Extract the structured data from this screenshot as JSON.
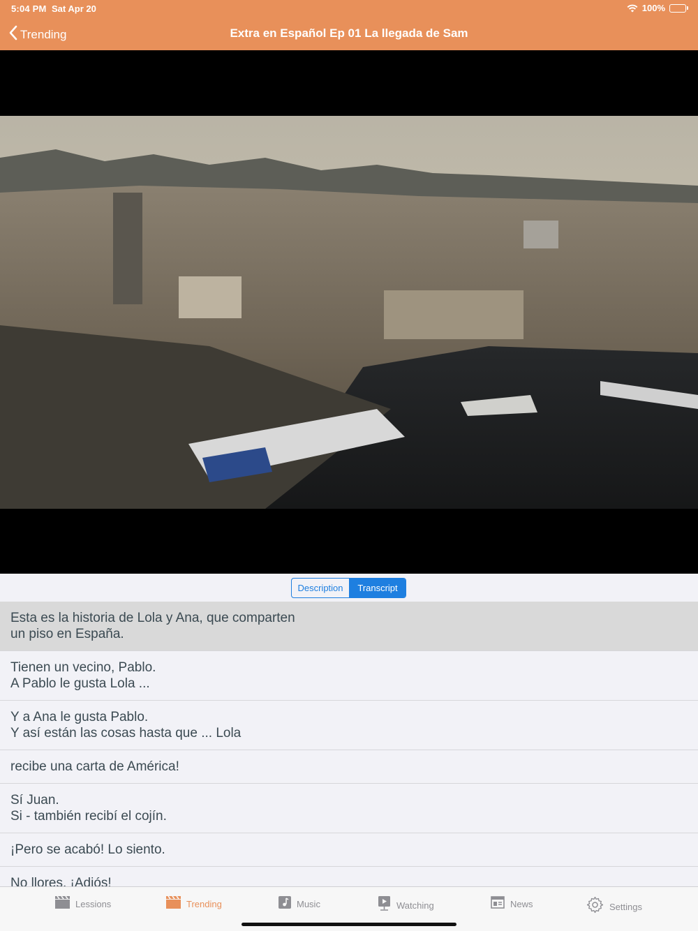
{
  "status": {
    "time": "5:04 PM",
    "date": "Sat Apr 20",
    "battery": "100%"
  },
  "nav": {
    "back_label": "Trending",
    "title": "Extra en Español Ep 01 La llegada de Sam"
  },
  "segments": [
    {
      "label": "Description",
      "selected": false
    },
    {
      "label": "Transcript",
      "selected": true
    }
  ],
  "transcript": [
    {
      "lines": [
        "Esta es la historia de Lola y Ana, que comparten",
        "un piso en España."
      ],
      "highlighted": true
    },
    {
      "lines": [
        "Tienen un vecino, Pablo.",
        "A Pablo le gusta Lola ..."
      ]
    },
    {
      "lines": [
        "Y a Ana le gusta Pablo.",
        "Y así están las cosas hasta que ... Lola"
      ]
    },
    {
      "lines": [
        "recibe una carta de América!"
      ]
    },
    {
      "lines": [
        "Sí Juan.",
        "Si - también recibí el cojín."
      ]
    },
    {
      "lines": [
        "¡Pero se acabó! Lo siento."
      ]
    },
    {
      "lines": [
        "No llores, ¡Adiós!"
      ]
    }
  ],
  "tabs": [
    {
      "label": "Lessions",
      "icon": "clapperboard-icon"
    },
    {
      "label": "Trending",
      "icon": "clapperboard-icon",
      "active": true
    },
    {
      "label": "Music",
      "icon": "music-note-icon"
    },
    {
      "label": "Watching",
      "icon": "play-screen-icon"
    },
    {
      "label": "News",
      "icon": "newspaper-icon"
    },
    {
      "label": "Settings",
      "icon": "gear-icon"
    }
  ],
  "colors": {
    "accent": "#e8905a",
    "segment_blue": "#1e7fe0",
    "text": "#3b4a52"
  }
}
